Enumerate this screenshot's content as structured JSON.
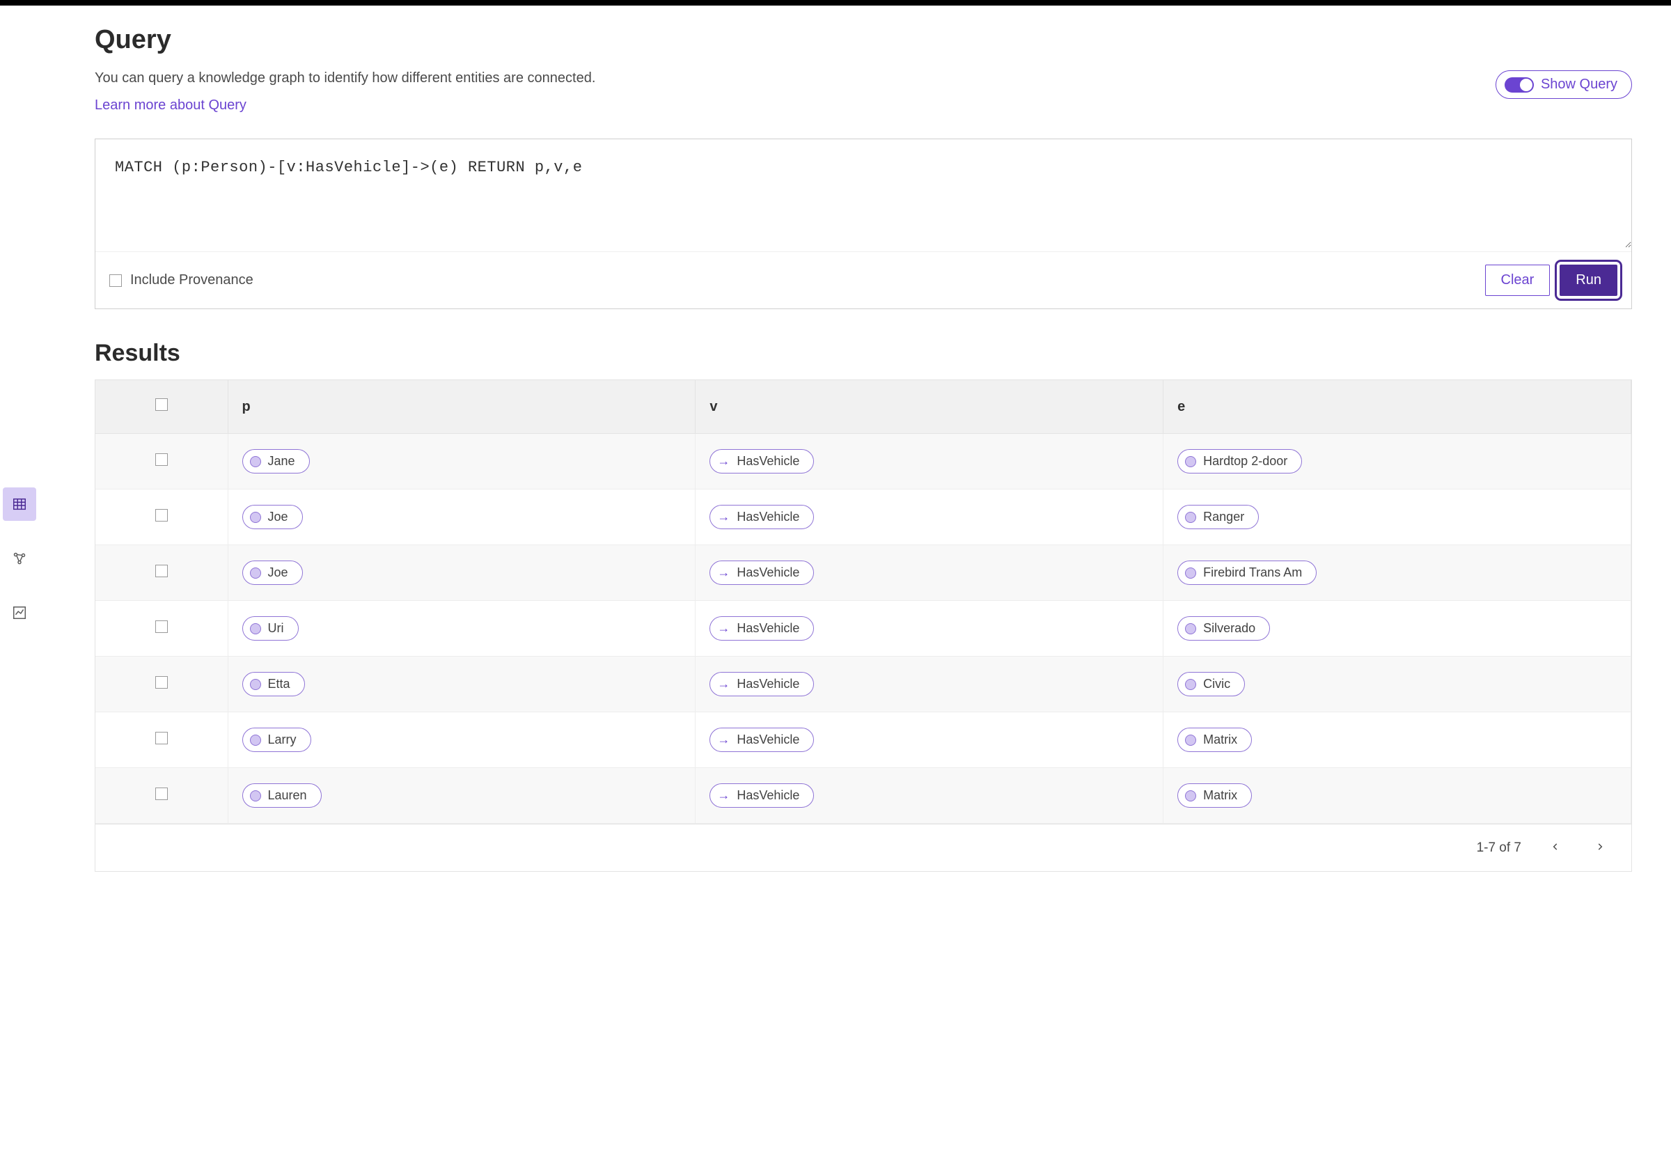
{
  "header": {
    "title": "Query",
    "description": "You can query a knowledge graph to identify how different entities are connected.",
    "learn_more": "Learn more about Query",
    "show_query_label": "Show Query"
  },
  "query": {
    "text": "MATCH (p:Person)-[v:HasVehicle]->(e) RETURN p,v,e",
    "include_provenance_label": "Include Provenance",
    "clear_label": "Clear",
    "run_label": "Run"
  },
  "results": {
    "title": "Results",
    "columns": [
      "p",
      "v",
      "e"
    ],
    "rows": [
      {
        "p": "Jane",
        "v": "HasVehicle",
        "e": "Hardtop 2-door"
      },
      {
        "p": "Joe",
        "v": "HasVehicle",
        "e": "Ranger"
      },
      {
        "p": "Joe",
        "v": "HasVehicle",
        "e": "Firebird Trans Am"
      },
      {
        "p": "Uri",
        "v": "HasVehicle",
        "e": "Silverado"
      },
      {
        "p": "Etta",
        "v": "HasVehicle",
        "e": "Civic"
      },
      {
        "p": "Larry",
        "v": "HasVehicle",
        "e": "Matrix"
      },
      {
        "p": "Lauren",
        "v": "HasVehicle",
        "e": "Matrix"
      }
    ],
    "pagination": "1-7 of 7"
  },
  "leftrail": {
    "tools": [
      {
        "name": "table-view-icon",
        "active": true
      },
      {
        "name": "graph-view-icon",
        "active": false
      },
      {
        "name": "chart-view-icon",
        "active": false
      }
    ]
  },
  "colors": {
    "accent": "#6b44d1",
    "accent_dark": "#4b2a94"
  }
}
